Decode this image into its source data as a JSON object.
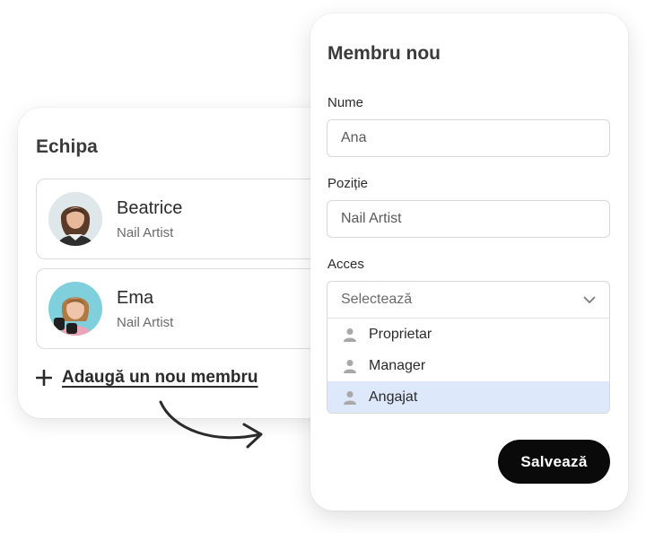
{
  "team": {
    "title": "Echipa",
    "members": [
      {
        "name": "Beatrice",
        "role": "Nail Artist"
      },
      {
        "name": "Ema",
        "role": "Nail Artist"
      }
    ],
    "add_label": "Adaugă un nou membru"
  },
  "form": {
    "title": "Membru nou",
    "name_label": "Nume",
    "name_value": "Ana",
    "position_label": "Poziție",
    "position_value": "Nail Artist",
    "access_label": "Acces",
    "access_placeholder": "Selectează",
    "access_options": [
      "Proprietar",
      "Manager",
      "Angajat"
    ],
    "access_highlighted": "Angajat",
    "save_label": "Salvează"
  },
  "icons": {
    "add": "plus-icon",
    "select": "chevron-down-icon",
    "option": "user-icon",
    "flow": "curved-arrow-icon"
  },
  "colors": {
    "highlight": "#dde8fb",
    "button": "#0a0a0a",
    "button_text": "#ffffff"
  }
}
